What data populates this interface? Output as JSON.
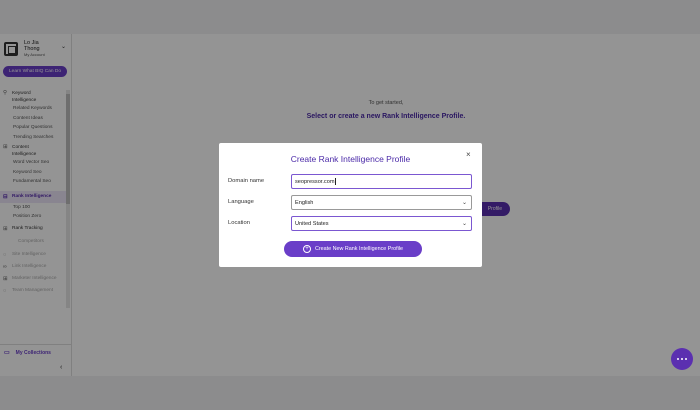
{
  "account": {
    "name_line1": "Lo Jia",
    "name_line2": "Thong",
    "subtitle": "My Account"
  },
  "sidebar": {
    "learn_button": "Learn What BIQ Can Do",
    "sections": [
      {
        "label": "Keyword Intelligence",
        "icon": "search-icon",
        "items": [
          "Related Keywords",
          "Content Ideas",
          "Popular Questions",
          "Trending Searches"
        ]
      },
      {
        "label": "Content Intelligence",
        "icon": "document-icon",
        "items": [
          "Word Vector Seo",
          "Keyword Seo",
          "Fundamental Seo"
        ]
      },
      {
        "label": "Rank Intelligence",
        "icon": "rank-icon",
        "items": [
          "Top 100",
          "Position Zero"
        ]
      },
      {
        "label": "Rank Tracking",
        "icon": "tracking-icon",
        "items": [
          "Competitors"
        ]
      }
    ],
    "disabled_items": [
      "Site Intelligence",
      "Link Intelligence",
      "Marketer Intelligence",
      "Team Management"
    ],
    "collections": "My Collections"
  },
  "main": {
    "hint": "To get started,",
    "title": "Select or create a new Rank Intelligence Profile.",
    "behind_button": "Profile"
  },
  "modal": {
    "title": "Create Rank Intelligence Profile",
    "close": "×",
    "domain_label": "Domain name",
    "domain_value": "seopressor.com",
    "language_label": "Language",
    "language_value": "English",
    "location_label": "Location",
    "location_value": "United States",
    "create_button": "Create New Rank Intelligence Profile"
  },
  "colors": {
    "accent": "#6a3ec8",
    "title": "#4b2aa8"
  }
}
